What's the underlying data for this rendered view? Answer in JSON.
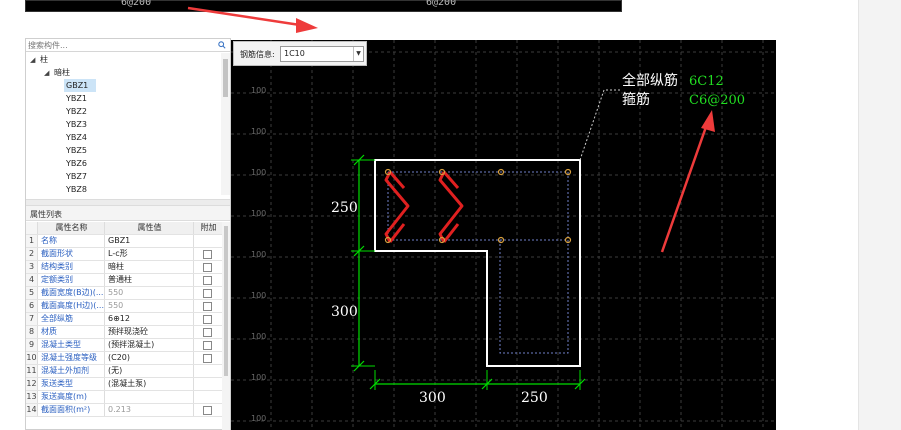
{
  "top_strip": {
    "left_label": "6@200",
    "right_label": "6@200"
  },
  "search": {
    "placeholder": "搜索构件..."
  },
  "tree": {
    "root": "柱",
    "group": "暗柱",
    "items": [
      "GBZ1",
      "YBZ1",
      "YBZ2",
      "YBZ3",
      "YBZ4",
      "YBZ5",
      "YBZ6",
      "YBZ7",
      "YBZ8"
    ],
    "selected": "GBZ1"
  },
  "properties": {
    "title": "属性列表",
    "columns": [
      "属性名称",
      "属性值",
      "附加"
    ],
    "rows": [
      {
        "num": "1",
        "name": "名称",
        "value": "GBZ1",
        "muted": false,
        "checkbox": false
      },
      {
        "num": "2",
        "name": "截面形状",
        "value": "L-c形",
        "muted": false,
        "checkbox": true
      },
      {
        "num": "3",
        "name": "结构类别",
        "value": "暗柱",
        "muted": false,
        "checkbox": true
      },
      {
        "num": "4",
        "name": "定额类别",
        "value": "普通柱",
        "muted": false,
        "checkbox": true
      },
      {
        "num": "5",
        "name": "截面宽度(B边)(...",
        "value": "550",
        "muted": true,
        "checkbox": true
      },
      {
        "num": "6",
        "name": "截面高度(H边)(...",
        "value": "550",
        "muted": true,
        "checkbox": true
      },
      {
        "num": "7",
        "name": "全部纵筋",
        "value": "6⊕12",
        "muted": false,
        "checkbox": true
      },
      {
        "num": "8",
        "name": "材质",
        "value": "预拌现浇砼",
        "muted": false,
        "checkbox": true
      },
      {
        "num": "9",
        "name": "混凝土类型",
        "value": "(预拌混凝土)",
        "muted": false,
        "checkbox": true
      },
      {
        "num": "10",
        "name": "混凝土强度等级",
        "value": "(C20)",
        "muted": false,
        "checkbox": true
      },
      {
        "num": "11",
        "name": "混凝土外加剂",
        "value": "(无)",
        "muted": false,
        "checkbox": false
      },
      {
        "num": "12",
        "name": "泵送类型",
        "value": "(混凝土泵)",
        "muted": false,
        "checkbox": false
      },
      {
        "num": "13",
        "name": "泵送高度(m)",
        "value": "",
        "muted": false,
        "checkbox": false
      },
      {
        "num": "14",
        "name": "截面面积(m²)",
        "value": "0.213",
        "muted": true,
        "checkbox": true
      }
    ]
  },
  "toolbar": {
    "label": "钢筋信息:",
    "selected_value": "1C10"
  },
  "drawing": {
    "grid_label": "100",
    "dimensions": {
      "left_upper": "250",
      "left_lower": "300",
      "bottom_left": "300",
      "bottom_right": "250"
    },
    "annotation": {
      "label_rebar": "全部纵筋",
      "value_rebar": "6C12",
      "label_stirrup": "箍筋",
      "value_stirrup": "C6@200"
    },
    "colors": {
      "background": "#000000",
      "grid": "#3c3c3c",
      "outline": "#ffffff",
      "dimension": "#00dd00",
      "rebar_tie": "#e02020",
      "bar_point": "#d8a040",
      "annotation_value": "#22dd22",
      "callout_arrow": "#ee3b3b"
    }
  }
}
